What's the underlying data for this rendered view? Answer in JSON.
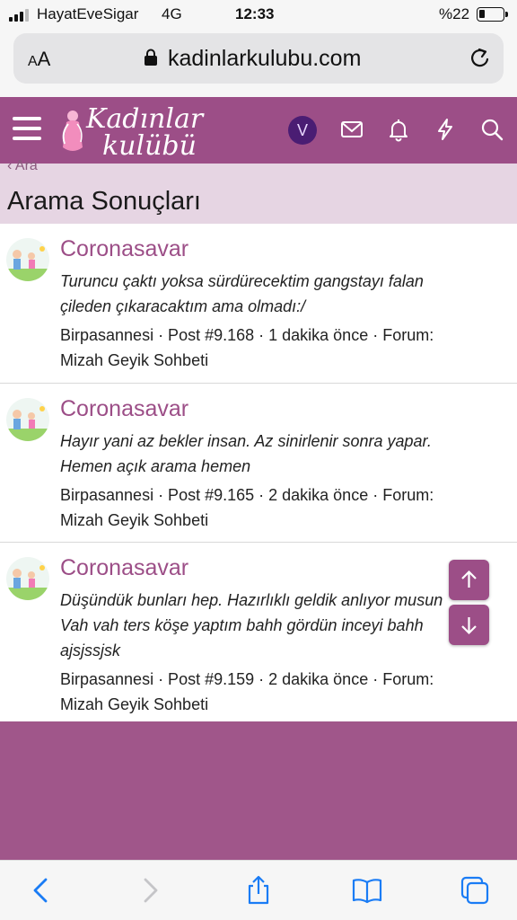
{
  "status_bar": {
    "carrier": "HayatEveSigar",
    "network": "4G",
    "time": "12:33",
    "battery": "%22",
    "battery_level": 0.22
  },
  "browser": {
    "text_size_label": "AA",
    "url": "kadinlarkulubu.com"
  },
  "site": {
    "logo_line1": "Kadınlar",
    "logo_line2": "kulübü",
    "user_initial": "V",
    "header_color": "#9c4e87",
    "accent_color": "#9c4e87"
  },
  "page": {
    "breadcrumb": "Ara",
    "title": "Arama Sonuçları"
  },
  "results": [
    {
      "title": "Coronasavar",
      "snippet_line1": "Turuncu çaktı yoksa sürdürecektim gangstayı falan",
      "snippet_line2": "çileden çıkaracaktım ama olmadı:/",
      "snippet_line3": "",
      "meta_line1": "Birpasannesi · Post #9.168 · 1 dakika önce · Forum:",
      "meta_line2": "Mizah Geyik Sohbeti"
    },
    {
      "title": "Coronasavar",
      "snippet_line1": "Hayır yani az bekler insan. Az sinirlenir sonra yapar.",
      "snippet_line2": "Hemen açık arama hemen",
      "snippet_line3": "",
      "meta_line1": "Birpasannesi · Post #9.165 · 2 dakika önce · Forum:",
      "meta_line2": "Mizah Geyik Sohbeti"
    },
    {
      "title": "Coronasavar",
      "snippet_line1": "Düşündük bunları hep. Hazırlıklı geldik anlıyor musun",
      "snippet_line2": "Vah vah ters köşe yaptım bahh gördün inceyi bahh",
      "snippet_line3": "ajsjssjsk",
      "meta_line1": "Birpasannesi · Post #9.159 · 2 dakika önce · Forum:",
      "meta_line2": "Mizah Geyik Sohbeti"
    }
  ],
  "icons": {
    "menu": "hamburger-icon",
    "messages": "envelope-icon",
    "alerts": "bell-icon",
    "whats_new": "lightning-icon",
    "search": "search-icon",
    "scroll_up": "arrow-up-icon",
    "scroll_down": "arrow-down-icon",
    "back": "chevron-left-icon",
    "forward": "chevron-right-icon",
    "share": "share-icon",
    "bookmarks": "book-icon",
    "tabs": "tabs-icon"
  }
}
